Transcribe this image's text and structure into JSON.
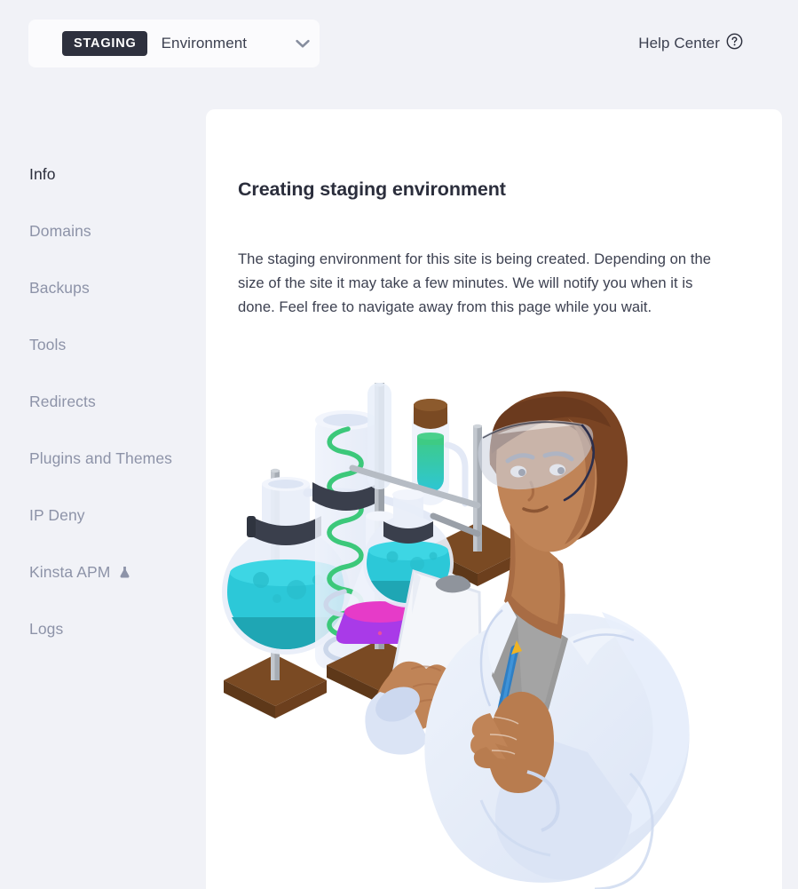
{
  "topbar": {
    "env_selector": {
      "badge": "STAGING",
      "label": "Environment",
      "chevron_icon": "chevron-down-icon"
    },
    "help_center": {
      "label": "Help Center",
      "icon": "question-circle-icon"
    }
  },
  "sidebar": {
    "items": [
      {
        "label": "Info",
        "active": true
      },
      {
        "label": "Domains",
        "active": false
      },
      {
        "label": "Backups",
        "active": false
      },
      {
        "label": "Tools",
        "active": false
      },
      {
        "label": "Redirects",
        "active": false
      },
      {
        "label": "Plugins and Themes",
        "active": false
      },
      {
        "label": "IP Deny",
        "active": false
      },
      {
        "label": "Kinsta APM",
        "active": false,
        "icon": "flask-icon"
      },
      {
        "label": "Logs",
        "active": false
      }
    ]
  },
  "main": {
    "title": "Creating staging environment",
    "body": "The staging environment for this site is being created. Depending on the size of the site it may take a few minutes. We will notify you when it is done. Feel free to navigate away from this page while you wait.",
    "illustration": {
      "name": "scientist-lab-illustration",
      "alt": "Isometric illustration of a scientist in a lab coat holding a pen and clipboard next to lab glassware"
    }
  },
  "colors": {
    "page_background": "#f1f2f7",
    "card_background": "#ffffff",
    "badge_background": "#2e313e",
    "badge_text": "#ffffff",
    "text_primary": "#2b2e3c",
    "text_secondary": "#3c4050",
    "nav_inactive": "#8d93a8",
    "liquid_cyan": "#2cc8d8",
    "liquid_cyan_dark": "#1fa6b4",
    "liquid_magenta": "#a93ae8",
    "liquid_magenta_top": "#e63bc8",
    "coil_green": "#3cc87a",
    "tube_green": "#3ecb84",
    "wood_brown": "#7a4a23",
    "wood_brown_dark": "#5e3819",
    "clamp_dark": "#3a3f4c",
    "stand_gray": "#9aa0a8",
    "coat_blue": "#dbe4f5",
    "coat_white": "#eef3fb",
    "skin": "#c08457",
    "skin_shadow": "#a86c44",
    "hair_brown": "#6b3a1e",
    "shirt_gray": "#9a9a9a",
    "pen_blue": "#2f7fc4",
    "pen_yellow": "#f0b323"
  }
}
